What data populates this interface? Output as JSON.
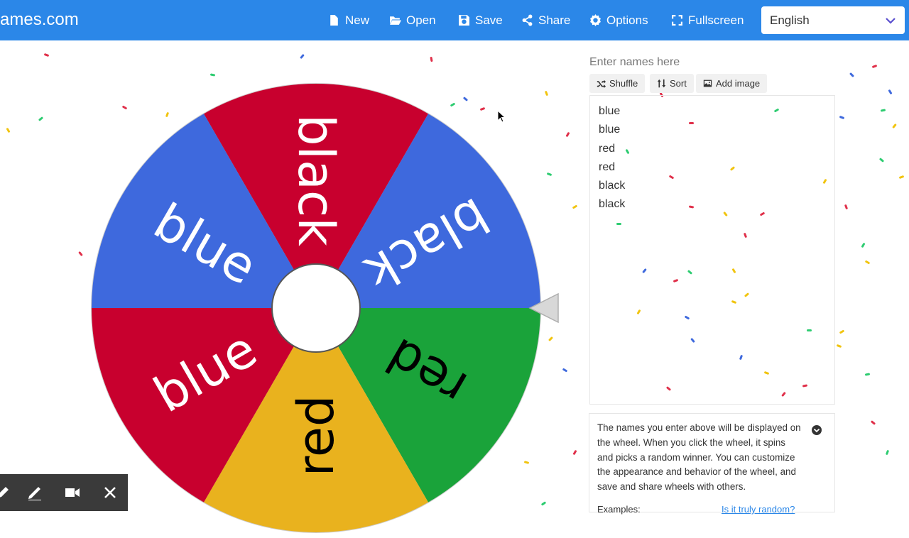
{
  "header": {
    "brand": "ames.com",
    "menu": [
      {
        "label": "New",
        "icon": "file-icon"
      },
      {
        "label": "Open",
        "icon": "folder-open-icon"
      },
      {
        "label": "Save",
        "icon": "save-icon"
      },
      {
        "label": "Share",
        "icon": "share-icon"
      },
      {
        "label": "Options",
        "icon": "gear-icon"
      },
      {
        "label": "Fullscreen",
        "icon": "fullscreen-icon"
      }
    ],
    "language": "English"
  },
  "wheel": {
    "slices": [
      {
        "label": "black",
        "color": "#c8002e"
      },
      {
        "label": "black",
        "color": "#3e69dd"
      },
      {
        "label": "red",
        "color": "#1aa33a"
      },
      {
        "label": "red",
        "color": "#e9b21e"
      },
      {
        "label": "blue",
        "color": "#c8002e"
      },
      {
        "label": "blue",
        "color": "#3e69dd"
      }
    ]
  },
  "entries": {
    "title": "Enter names here",
    "buttons": {
      "shuffle": "Shuffle",
      "sort": "Sort",
      "add_image": "Add image"
    },
    "names": [
      "blue",
      "blue",
      "red",
      "red",
      "black",
      "black"
    ]
  },
  "info": {
    "text": "The names you enter above will be displayed on the wheel. When you click the wheel, it spins and picks a random winner. You can customize the appearance and behavior of the wheel, and save and share wheels with others.",
    "examples_label": "Examples:",
    "random_link": "Is it truly random?"
  },
  "colors": {
    "topbar": "#2b87e8",
    "red": "#c8002e",
    "blue": "#3e69dd",
    "green": "#1aa33a",
    "yellow": "#e9b21e"
  }
}
